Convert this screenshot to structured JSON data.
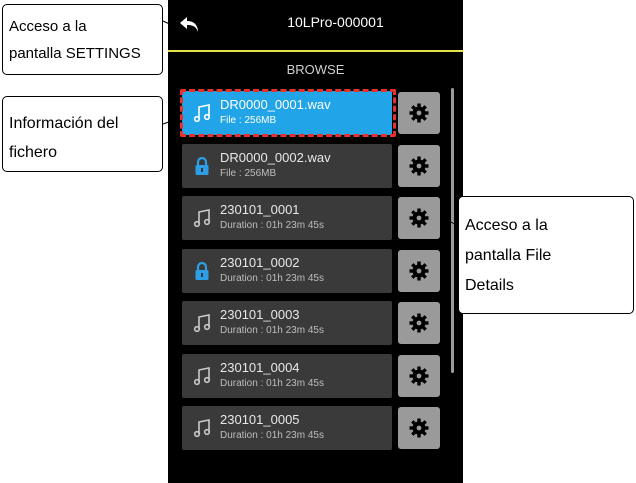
{
  "device": {
    "title": "10LPro-000001",
    "section_title": "BROWSE",
    "accent_yellow": "#e6e24a",
    "selected_color": "#22a5e8",
    "highlight_color": "#e8312f"
  },
  "files": [
    {
      "name": "DR0000_0001.wav",
      "detail": "File : 256MB",
      "icon": "music-note-icon",
      "selected": true
    },
    {
      "name": "DR0000_0002.wav",
      "detail": "File : 256MB",
      "icon": "lock-icon",
      "selected": false
    },
    {
      "name": "230101_0001",
      "detail": "Duration : 01h 23m 45s",
      "icon": "music-note-icon",
      "selected": false
    },
    {
      "name": "230101_0002",
      "detail": "Duration : 01h 23m 45s",
      "icon": "lock-icon",
      "selected": false
    },
    {
      "name": "230101_0003",
      "detail": "Duration : 01h 23m 45s",
      "icon": "music-note-icon",
      "selected": false
    },
    {
      "name": "230101_0004",
      "detail": "Duration : 01h 23m 45s",
      "icon": "music-note-icon",
      "selected": false
    },
    {
      "name": "230101_0005",
      "detail": "Duration : 01h 23m 45s",
      "icon": "music-note-icon",
      "selected": false
    }
  ],
  "callouts": {
    "settings": {
      "line1": "Acceso a la",
      "line2": "pantalla SETTINGS"
    },
    "file_info": {
      "line1": "Información del",
      "line2": "fichero"
    },
    "file_details": {
      "line1": "Acceso a la",
      "line2": "pantalla File",
      "line3": "Details"
    }
  }
}
